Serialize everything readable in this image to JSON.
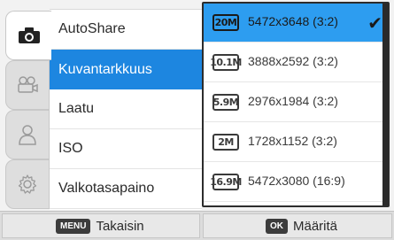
{
  "tabs": [
    {
      "icon": "camera-icon",
      "active": true
    },
    {
      "icon": "video-camera-icon",
      "active": false
    },
    {
      "icon": "person-icon",
      "active": false
    },
    {
      "icon": "gear-icon",
      "active": false
    }
  ],
  "menu": {
    "items": [
      {
        "label": "AutoShare"
      },
      {
        "label": "Kuvantarkkuus"
      },
      {
        "label": "Laatu"
      },
      {
        "label": "ISO"
      },
      {
        "label": "Valkotasapaino"
      }
    ],
    "selected_index": 1
  },
  "options": {
    "items": [
      {
        "badge": "20M",
        "label": "5472x3648 (3:2)",
        "selected": true
      },
      {
        "badge": "10.1M",
        "label": "3888x2592 (3:2)",
        "selected": false
      },
      {
        "badge": "5.9M",
        "label": "2976x1984 (3:2)",
        "selected": false
      },
      {
        "badge": "2M",
        "label": "1728x1152 (3:2)",
        "selected": false
      },
      {
        "badge": "16.9M",
        "label": "5472x3080 (16:9)",
        "selected": false
      }
    ],
    "check_glyph": "✔"
  },
  "bottom": {
    "back_key": "MENU",
    "back_label": "Takaisin",
    "ok_key": "OK",
    "ok_label": "Määritä"
  },
  "colors": {
    "menu_selected": "#1d86e0",
    "option_selected": "#2d9df0"
  }
}
